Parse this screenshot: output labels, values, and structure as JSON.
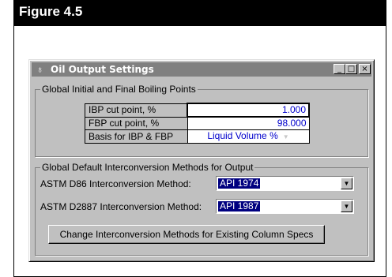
{
  "figure": {
    "label": "Figure 4.5"
  },
  "window": {
    "title": "Oil Output Settings",
    "title_icon": "oil-drop-icon",
    "controls": {
      "minimize": "_",
      "maximize": "□",
      "close": "×"
    }
  },
  "boiling_points": {
    "group_label": "Global Initial and Final Boiling Points",
    "rows": [
      {
        "label": "IBP cut point, %",
        "value": "1.000"
      },
      {
        "label": "FBP cut point, %",
        "value": "98.000"
      },
      {
        "label": "Basis for IBP & FBP",
        "value": "Liquid Volume %"
      }
    ]
  },
  "interconversion": {
    "group_label": "Global Default Interconversion Methods for Output",
    "d86_label": "ASTM D86 Interconversion Method:",
    "d86_value": "API 1974",
    "d2887_label": "ASTM D2887 Interconversion Method:",
    "d2887_value": "API 1987",
    "change_button": "Change Interconversion Methods for Existing Column Specs"
  }
}
